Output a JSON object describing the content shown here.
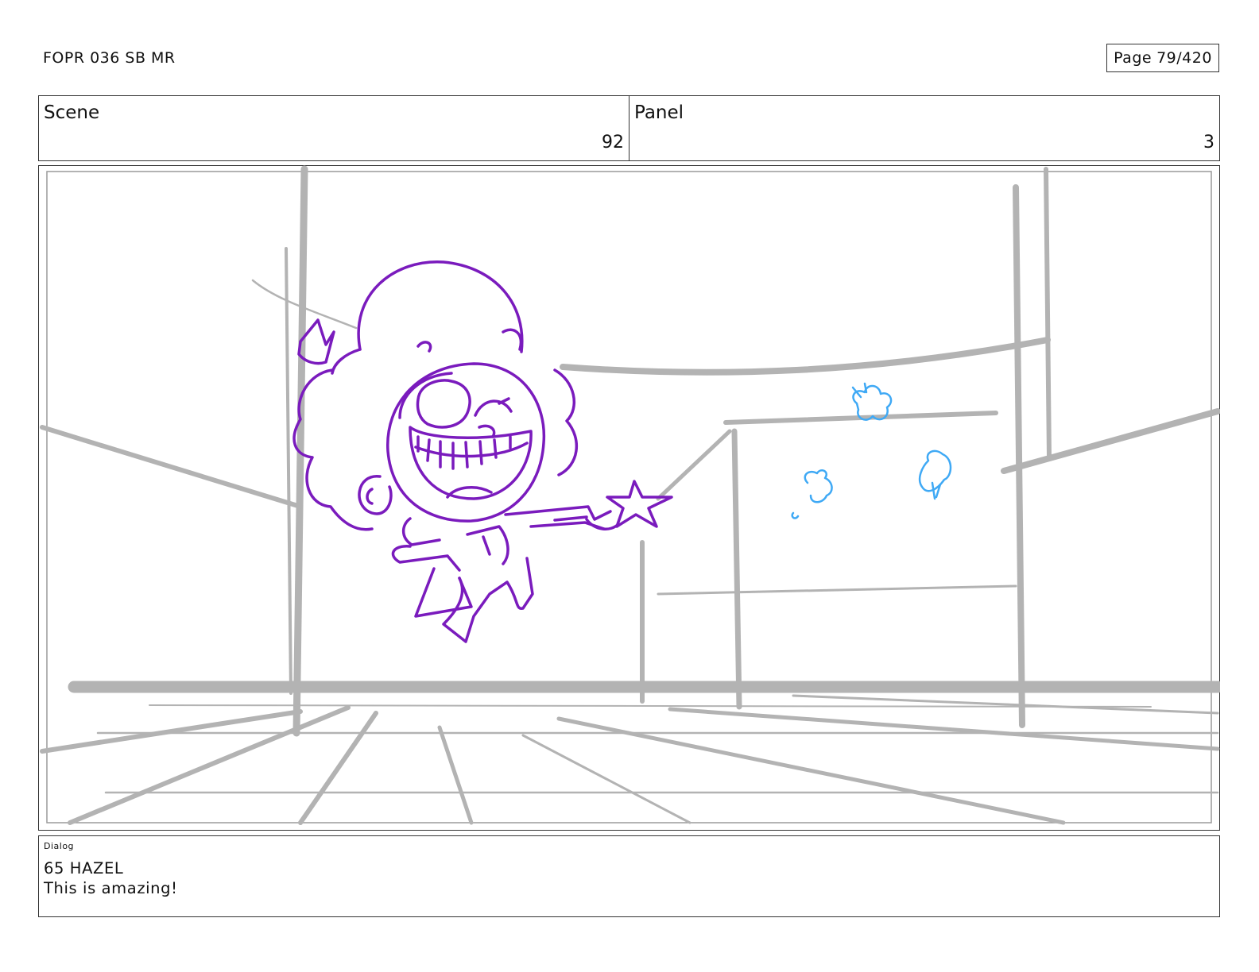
{
  "header": {
    "doc_id": "FOPR 036 SB MR",
    "page_label": "Page",
    "page_value": "79/420"
  },
  "info": {
    "scene_label": "Scene",
    "scene_value": "92",
    "panel_label": "Panel",
    "panel_value": "3"
  },
  "dialog": {
    "label": "Dialog",
    "line1": "65 HAZEL",
    "line2": "This is amazing!"
  },
  "colors": {
    "background_sketch": "#b3b3b3",
    "character_sketch": "#7a1bbd",
    "sparkle_sketch": "#3fa9f5"
  }
}
